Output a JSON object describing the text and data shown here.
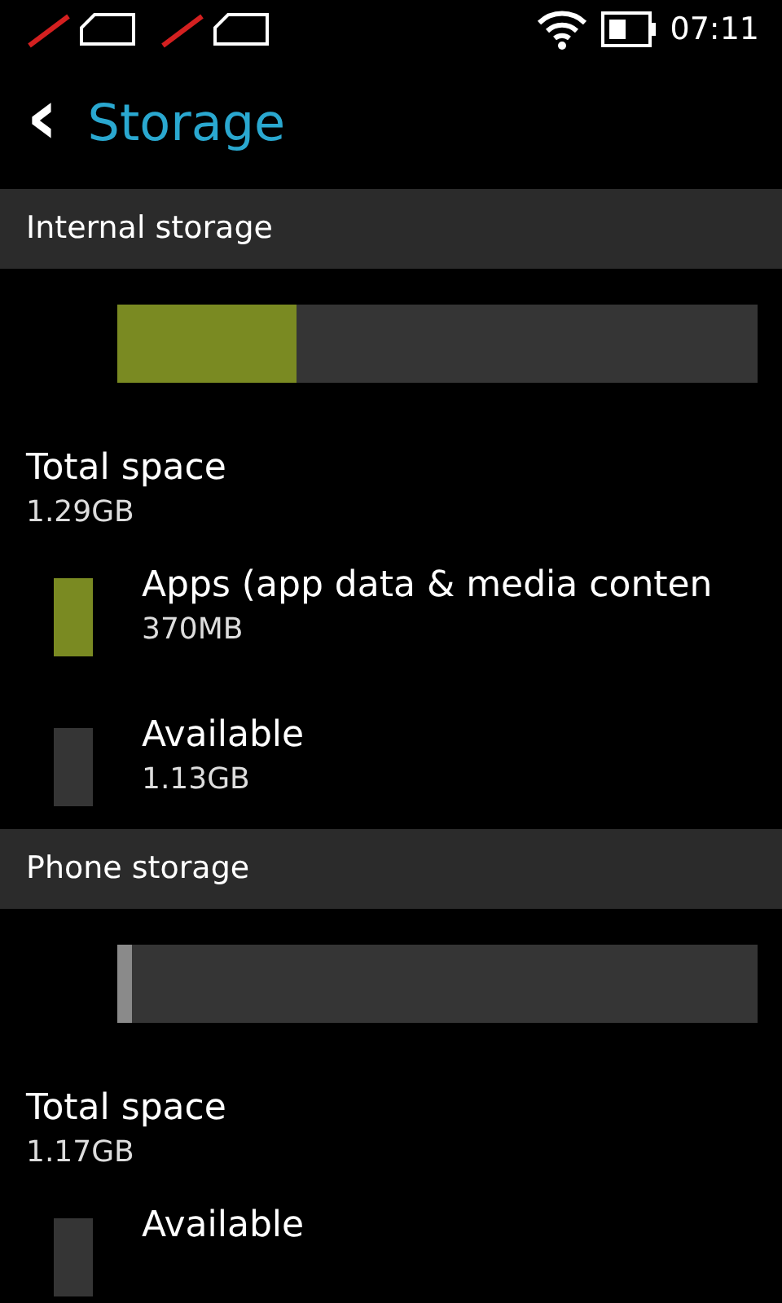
{
  "status_bar": {
    "time": "07:11"
  },
  "header": {
    "back": "‹",
    "title": "Storage"
  },
  "sections": [
    {
      "title": "Internal storage",
      "bar": {
        "level": 0.28,
        "color": "#7a8a22"
      },
      "total_label": "Total space",
      "total_value": "1.29GB",
      "legend": [
        {
          "label": "Apps (app data & media conten",
          "value": "370MB",
          "color": "#7a8a22"
        },
        {
          "label": "Available",
          "value": "1.13GB",
          "color": "#353535"
        }
      ]
    },
    {
      "title": "Phone storage",
      "bar": {
        "level": 0.023,
        "color": "#8a8a8a"
      },
      "total_label": "Total space",
      "total_value": "1.17GB",
      "legend": [
        {
          "label": "Available",
          "color": "#353535"
        }
      ]
    }
  ]
}
